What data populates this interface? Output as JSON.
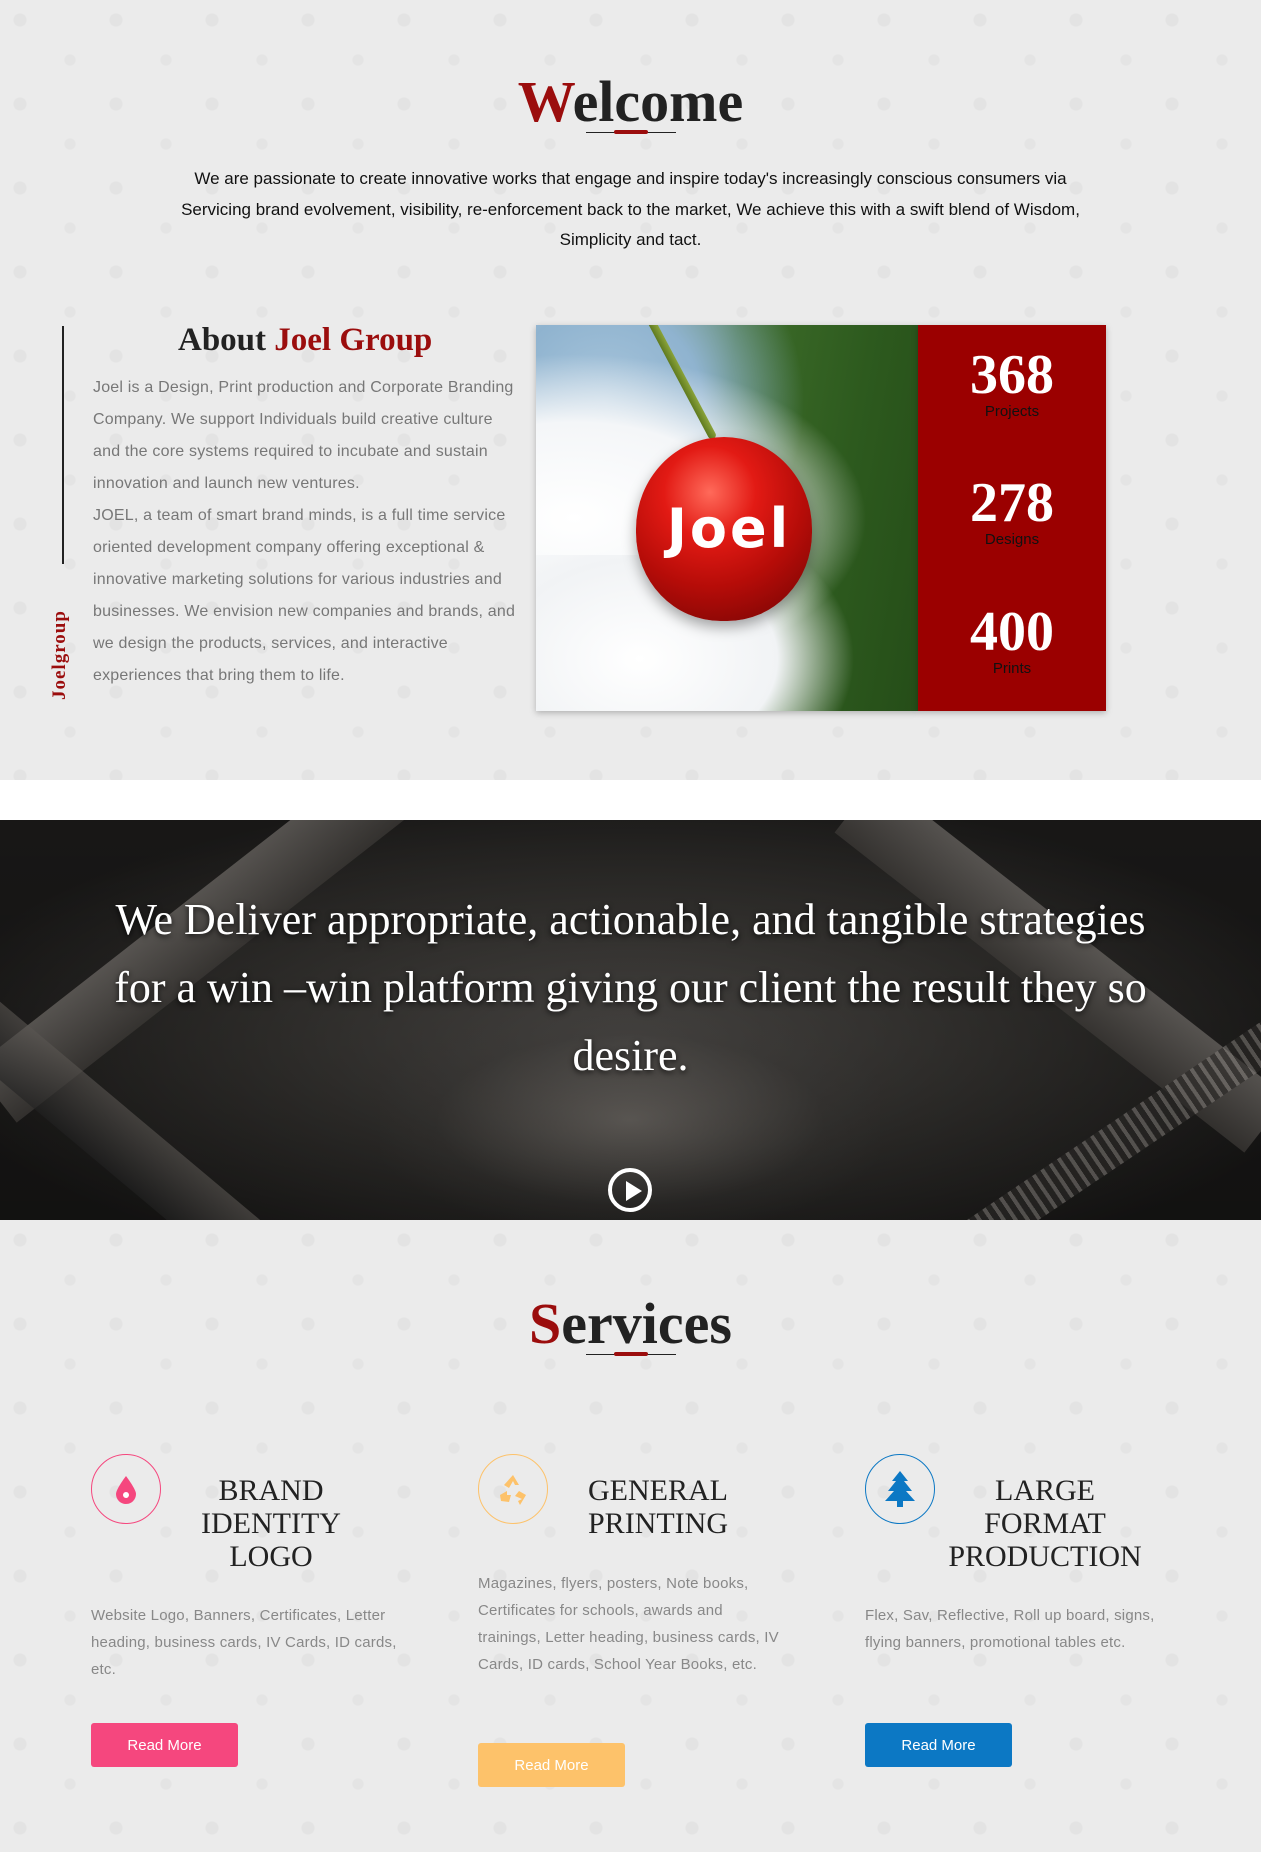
{
  "welcome": {
    "heading_first": "W",
    "heading_rest": "elcome",
    "text": "We are passionate to create innovative works that engage and inspire today's increasingly conscious consumers via Servicing brand evolvement, visibility, re-enforcement back to the market, We achieve this with a swift blend of Wisdom, Simplicity and tact."
  },
  "about": {
    "title_prefix": "About",
    "title_highlight": "Joel Group",
    "vertical_label": "Joelgroup",
    "paragraph_1": "Joel is a Design, Print production and Corporate Branding Company. We support Individuals build creative culture and the core systems required to incubate and sustain innovation and launch new ventures.",
    "paragraph_2": "JOEL, a team of smart brand minds, is a full time service oriented development company offering exceptional & innovative marketing solutions for various industries and businesses. We envision new companies and brands, and we design the products, services, and interactive experiences that bring them to life.",
    "image_text": "Joel"
  },
  "stats": [
    {
      "value": "368",
      "label": "Projects"
    },
    {
      "value": "278",
      "label": "Designs"
    },
    {
      "value": "400",
      "label": "Prints"
    }
  ],
  "banner": {
    "quote": "We Deliver appropriate, actionable, and tangible strategies for a win –win platform giving our client the result they so desire.",
    "play_icon": "play-circle-icon"
  },
  "services": {
    "heading_first": "S",
    "heading_rest": "ervices",
    "items": [
      {
        "title": "BRAND IDENTITY LOGO",
        "description": "Website Logo, Banners, Certificates, Letter heading, business cards, IV Cards, ID cards, etc.",
        "button": "Read More",
        "icon": "drop-icon",
        "color": "#f5477e"
      },
      {
        "title": "GENERAL PRINTING",
        "description": "Magazines, flyers, posters, Note books, Certificates for schools, awards and trainings, Letter heading, business cards, IV Cards, ID cards, School Year Books, etc.",
        "button": "Read More",
        "icon": "recycle-icon",
        "color": "#fdc26a"
      },
      {
        "title": "LARGE FORMAT PRODUCTION",
        "description": "Flex, Sav, Reflective, Roll up board, signs, flying banners, promotional tables etc.",
        "button": "Read More",
        "icon": "tree-icon",
        "color": "#0c78c4"
      }
    ]
  },
  "colors": {
    "accent_red": "#9b0d0d",
    "stats_red": "#9b0000"
  }
}
